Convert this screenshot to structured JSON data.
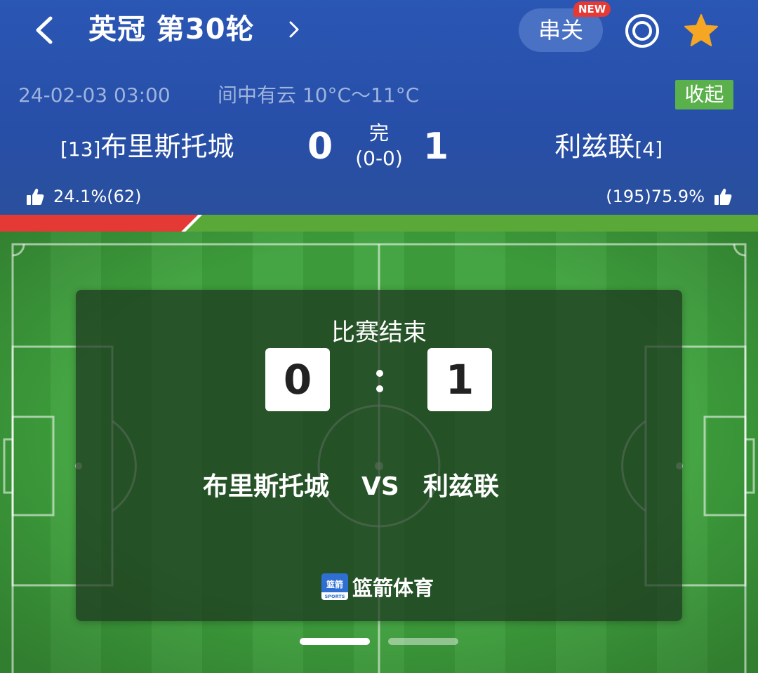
{
  "header": {
    "title": "英冠 第30轮",
    "parlay_label": "串关",
    "new_badge": "NEW",
    "icons": {
      "back": "back-chevron-icon",
      "forward": "chevron-right-icon",
      "target": "target-icon",
      "favorite": "star-icon"
    },
    "accent_color": "#f5a623"
  },
  "match": {
    "datetime": "24-02-03 03:00",
    "weather": "间中有云 10°C～11°C",
    "collapse_label": "收起",
    "home_rank": "[13]",
    "home_team": "布里斯托城",
    "away_team": "利兹联",
    "away_rank": "[4]",
    "home_score": "0",
    "away_score": "1",
    "status": "完",
    "halftime": "(0-0)"
  },
  "votes": {
    "home_label": "24.1%(62)",
    "away_label": "(195)75.9%",
    "home_percent": 24.1,
    "away_percent": 75.9,
    "home_color": "#e53935",
    "away_color": "#5aa838"
  },
  "card": {
    "status": "比赛结束",
    "home_score": "0",
    "away_score": "1",
    "home_team": "布里斯托城",
    "vs": "VS",
    "away_team": "利兹联",
    "brand": "篮箭体育",
    "brand_logo_text": "篮箭",
    "brand_logo_sub": "SPORTS"
  },
  "pager": {
    "pages": 2,
    "active": 1
  }
}
